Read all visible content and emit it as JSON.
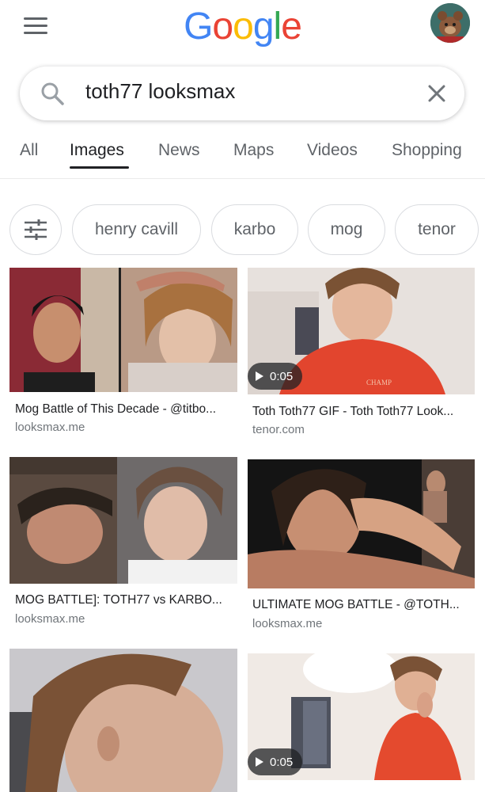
{
  "logo": [
    "G",
    "o",
    "o",
    "g",
    "l",
    "e"
  ],
  "logo_colors": [
    "#4285F4",
    "#EA4335",
    "#FBBC05",
    "#4285F4",
    "#34A853",
    "#EA4335"
  ],
  "search": {
    "query": "toth77 looksmax"
  },
  "tabs": [
    "All",
    "Images",
    "News",
    "Maps",
    "Videos",
    "Shopping"
  ],
  "active_tab": "Images",
  "chips": [
    "henry cavill",
    "karbo",
    "mog",
    "tenor"
  ],
  "results": [
    {
      "title": "Mog Battle of This Decade - @titbo...",
      "source": "looksmax.me"
    },
    {
      "title": "Toth Toth77 GIF - Toth Toth77 Look...",
      "source": "tenor.com",
      "duration": "0:05"
    },
    {
      "title": "MOG BATTLE]: TOTH77 vs KARBO...",
      "source": "looksmax.me"
    },
    {
      "title": "ULTIMATE MOG BATTLE - @TOTH...",
      "source": "looksmax.me"
    },
    {
      "title": "",
      "source": ""
    },
    {
      "title": "",
      "source": "",
      "duration": "0:05"
    }
  ]
}
